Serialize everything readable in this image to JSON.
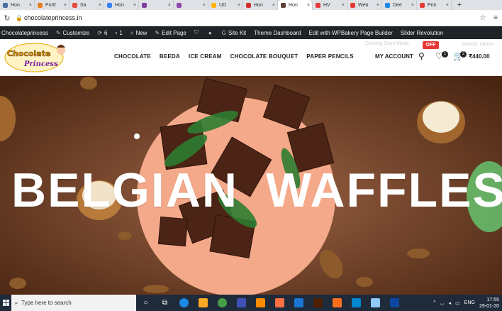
{
  "browser": {
    "tabs": [
      {
        "label": "Hon",
        "color": "#4a6fa5"
      },
      {
        "label": "Portf",
        "color": "#e67e22"
      },
      {
        "label": "Sa",
        "color": "#e74c3c"
      },
      {
        "label": "Hon",
        "color": "#3b82f6"
      },
      {
        "label": "",
        "color": "#7b3fa0"
      },
      {
        "label": "",
        "color": "#8e44ad"
      },
      {
        "label": "UD",
        "color": "#ffb300"
      },
      {
        "label": "Hon",
        "color": "#d32f2f"
      },
      {
        "label": "Hon",
        "color": "#5d4037"
      },
      {
        "label": "HV",
        "color": "#e53935"
      },
      {
        "label": "Web",
        "color": "#e53935"
      },
      {
        "label": "Dee",
        "color": "#1e88e5"
      },
      {
        "label": "Prin",
        "color": "#e53935"
      }
    ],
    "url": "chocolateprincess.in"
  },
  "wpbar": {
    "site": "Chocolateprincess",
    "customize": "Customize",
    "updates": "6",
    "comments": "1",
    "new": "New",
    "edit_page": "Edit Page",
    "site_kit": "Site Kit",
    "theme_dashboard": "Theme Dashboard",
    "wpbakery": "Edit with WPBakery Page Builder",
    "slider": "Slider Revolution"
  },
  "header": {
    "logo_text": "Chocolate Princess",
    "nav": [
      "CHOCOLATE",
      "BEEDA",
      "ICE CREAM",
      "CHOCOLATE BOUQUET",
      "PAPER PENCILS"
    ],
    "account": "MY ACCOUNT",
    "wishlist_count": "1",
    "cart_count": "2",
    "cart_total": "₹440.00",
    "coming_soon": "Coming Soon Mode",
    "off": "OFF",
    "howdy": "Howdy, admin"
  },
  "hero": {
    "headline_left": "BELGIAN",
    "headline_right": "WAFFLES"
  },
  "taskbar": {
    "search_placeholder": "Type here to search",
    "lang": "ENG",
    "time": "17:55",
    "date": "29-01-20"
  }
}
